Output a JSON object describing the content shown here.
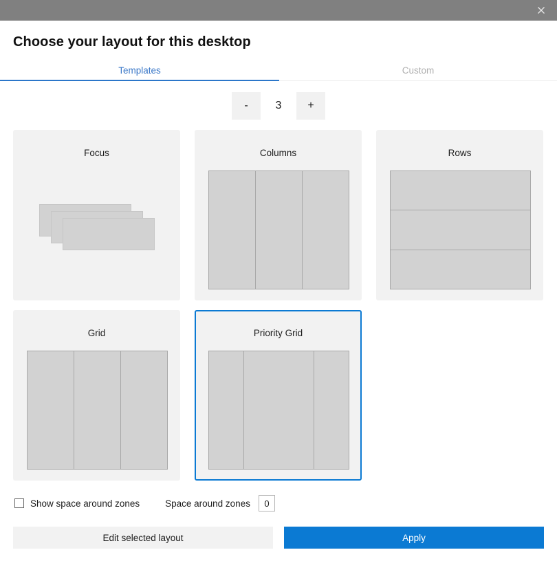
{
  "titlebar": {
    "close_label": "×",
    "close_icon": "close-icon",
    "background": "#808080"
  },
  "header": {
    "title": "Choose your layout for this desktop"
  },
  "tabs": {
    "accent_color": "#2b76c9",
    "items": [
      {
        "label": "Templates",
        "selected": true
      },
      {
        "label": "Custom",
        "selected": false
      }
    ]
  },
  "stepper": {
    "decrement_label": "-",
    "increment_label": "+",
    "value": "3"
  },
  "layouts": [
    {
      "name": "Focus",
      "preview_type": "focus",
      "zones": 3,
      "selected": false
    },
    {
      "name": "Columns",
      "preview_type": "columns",
      "zones": 3,
      "column_ratios": [
        1,
        1,
        1
      ],
      "selected": false
    },
    {
      "name": "Rows",
      "preview_type": "rows",
      "zones": 3,
      "row_ratios": [
        1,
        1,
        1
      ],
      "selected": false
    },
    {
      "name": "Grid",
      "preview_type": "grid",
      "zones": 3,
      "column_ratios": [
        1,
        1,
        1
      ],
      "selected": false
    },
    {
      "name": "Priority Grid",
      "preview_type": "priority-grid",
      "zones": 3,
      "column_ratios": [
        1,
        2,
        1
      ],
      "selected": true
    }
  ],
  "options": {
    "show_space_label": "Show space around zones",
    "show_space_checked": false,
    "space_label": "Space around zones",
    "space_value": "0"
  },
  "footer": {
    "edit_label": "Edit selected layout",
    "apply_label": "Apply",
    "apply_color": "#0b7ad3"
  }
}
